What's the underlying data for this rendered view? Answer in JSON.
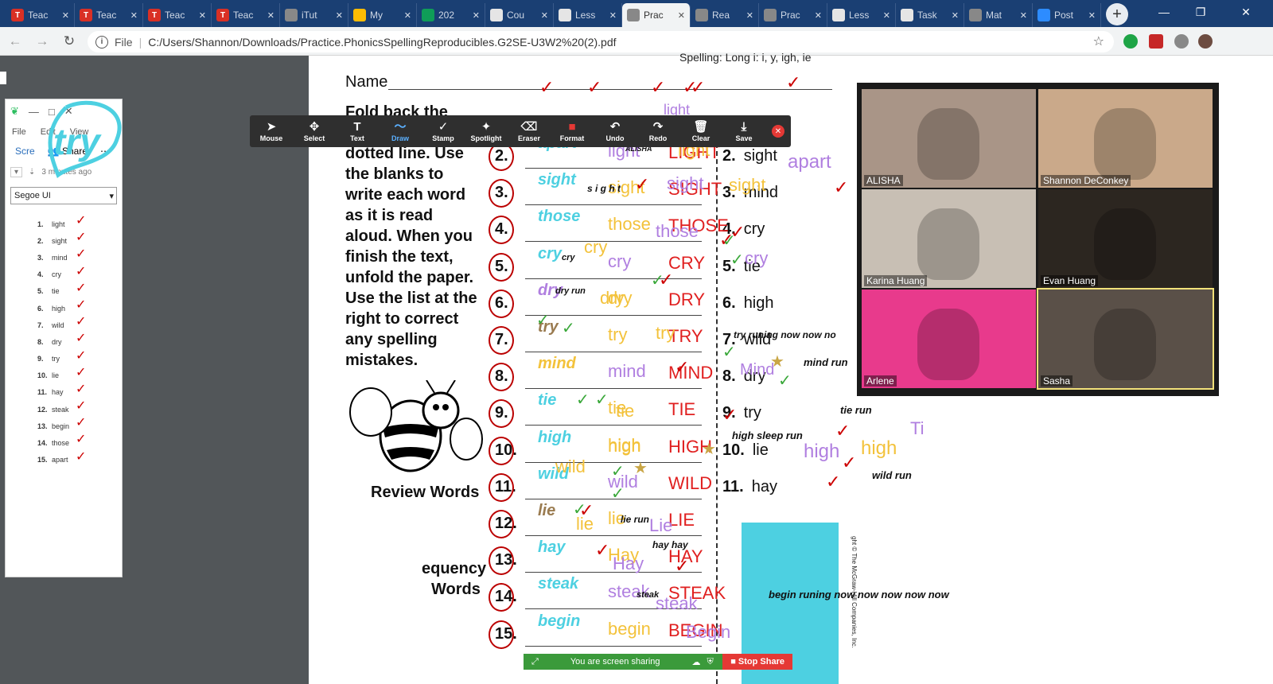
{
  "tabs": [
    {
      "label": "Teac",
      "icon": "teachable-icon",
      "color": "#d93025",
      "active": false
    },
    {
      "label": "Teac",
      "icon": "teachable-icon",
      "color": "#d93025",
      "active": false
    },
    {
      "label": "Teac",
      "icon": "teachable-icon",
      "color": "#d93025",
      "active": false
    },
    {
      "label": "Teac",
      "icon": "teachable-icon",
      "color": "#d93025",
      "active": false
    },
    {
      "label": "iTut",
      "icon": "itutor-icon",
      "color": "#888888",
      "active": false
    },
    {
      "label": "My",
      "icon": "drive-icon",
      "color": "#fbbc04",
      "active": false
    },
    {
      "label": "202",
      "icon": "sheets-icon",
      "color": "#0f9d58",
      "active": false
    },
    {
      "label": "Cou",
      "icon": "classroom-icon",
      "color": "#e5e5e5",
      "active": false
    },
    {
      "label": "Less",
      "icon": "lesson-icon",
      "color": "#e5e5e5",
      "active": false
    },
    {
      "label": "Prac",
      "icon": "pdf-icon",
      "color": "#888888",
      "active": true
    },
    {
      "label": "Rea",
      "icon": "pdf-icon",
      "color": "#888888",
      "active": false
    },
    {
      "label": "Prac",
      "icon": "pdf-icon",
      "color": "#888888",
      "active": false
    },
    {
      "label": "Less",
      "icon": "lesson-icon",
      "color": "#e5e5e5",
      "active": false
    },
    {
      "label": "Task",
      "icon": "lesson-icon",
      "color": "#e5e5e5",
      "active": false
    },
    {
      "label": "Mat",
      "icon": "pdf-icon",
      "color": "#888888",
      "active": false
    },
    {
      "label": "Post",
      "icon": "zoom-icon",
      "color": "#2d8cff",
      "active": false
    }
  ],
  "address": {
    "scheme": "File",
    "url": "C:/Users/Shannon/Downloads/Practice.PhonicsSpellingReproducibles.G2SE-U3W2%20(2).pdf"
  },
  "notes_app": {
    "menu": [
      "File",
      "Edit",
      "View"
    ],
    "screen_label": "Scre",
    "share_label": "Share",
    "time_label": "3 minutes ago",
    "font": "Segoe UI",
    "handwritten": "try",
    "list": [
      {
        "n": "1.",
        "w": "light"
      },
      {
        "n": "2.",
        "w": "sight"
      },
      {
        "n": "3.",
        "w": "mind"
      },
      {
        "n": "4.",
        "w": "cry"
      },
      {
        "n": "5.",
        "w": "tie"
      },
      {
        "n": "6.",
        "w": "high"
      },
      {
        "n": "7.",
        "w": "wild"
      },
      {
        "n": "8.",
        "w": "dry"
      },
      {
        "n": "9.",
        "w": "try"
      },
      {
        "n": "10.",
        "w": "lie"
      },
      {
        "n": "11.",
        "w": "hay"
      },
      {
        "n": "12.",
        "w": "steak"
      },
      {
        "n": "13.",
        "w": "begin"
      },
      {
        "n": "14.",
        "w": "those"
      },
      {
        "n": "15.",
        "w": "apart"
      }
    ]
  },
  "annotate_toolbar": [
    {
      "label": "Mouse",
      "icon": "mouse-pointer-icon",
      "glyph": "➤"
    },
    {
      "label": "Select",
      "icon": "move-icon",
      "glyph": "✥"
    },
    {
      "label": "Text",
      "icon": "text-icon",
      "glyph": "T"
    },
    {
      "label": "Draw",
      "icon": "draw-icon",
      "glyph": "〜",
      "active": true
    },
    {
      "label": "Stamp",
      "icon": "stamp-icon",
      "glyph": "✓"
    },
    {
      "label": "Spotlight",
      "icon": "spotlight-icon",
      "glyph": "✦"
    },
    {
      "label": "Eraser",
      "icon": "eraser-icon",
      "glyph": "⌫"
    },
    {
      "label": "Format",
      "icon": "format-icon",
      "glyph": "■"
    },
    {
      "label": "Undo",
      "icon": "undo-icon",
      "glyph": "↶"
    },
    {
      "label": "Redo",
      "icon": "redo-icon",
      "glyph": "↷"
    },
    {
      "label": "Clear",
      "icon": "trash-icon",
      "glyph": "🗑"
    },
    {
      "label": "Save",
      "icon": "save-icon",
      "glyph": "⤓"
    }
  ],
  "worksheet": {
    "header": "Spelling: Long i: i, y, igh, ie",
    "name_label": "Name",
    "instructions": [
      "Fold back the",
      "paper along the",
      "dotted line. Use",
      "the blanks to",
      "write each word",
      "as it is read",
      "aloud. When you",
      "finish the text,",
      "unfold the paper.",
      "Use the list at the",
      "right to correct",
      "any spelling",
      "mistakes."
    ],
    "review_words": "Review Words",
    "high_freq": [
      "equency",
      "Words"
    ],
    "copyright": "ght © The McGraw-Hill Companies, Inc.",
    "nums": [
      "2.",
      "3.",
      "4.",
      "5.",
      "6.",
      "7.",
      "8.",
      "9.",
      "10.",
      "11.",
      "12.",
      "13.",
      "14.",
      "15."
    ],
    "right_list": [
      {
        "n": "2.",
        "w": "sight"
      },
      {
        "n": "3.",
        "w": "mind"
      },
      {
        "n": "4.",
        "w": "cry"
      },
      {
        "n": "5.",
        "w": "tie"
      },
      {
        "n": "6.",
        "w": "high"
      },
      {
        "n": "7.",
        "w": "wild"
      },
      {
        "n": "8.",
        "w": "dry"
      },
      {
        "n": "9.",
        "w": "try"
      },
      {
        "n": "10.",
        "w": "lie"
      },
      {
        "n": "11.",
        "w": "hay"
      }
    ]
  },
  "annotations": {
    "col1": [
      "apart",
      "sight",
      "those",
      "cry",
      "dry",
      "try",
      "mind",
      "tie",
      "high",
      "wild",
      "lie",
      "hay",
      "steak",
      "begin"
    ],
    "col1_colors": [
      "#4dd0e1",
      "#4dd0e1",
      "#4dd0e1",
      "#4dd0e1",
      "#b07fe0",
      "#9a7b50",
      "#f3c23b",
      "#4dd0e1",
      "#4dd0e1",
      "#4dd0e1",
      "#9a7b50",
      "#4dd0e1",
      "#4dd0e1",
      "#4dd0e1"
    ],
    "col2": [
      "light",
      "sight",
      "those",
      "cry",
      "dry",
      "try",
      "mind",
      "tie",
      "high",
      "wild",
      "lie",
      "Hay",
      "steak",
      "begin"
    ],
    "col3": [
      "LIGHT",
      "SIGHT",
      "THOSE",
      "CRY",
      "DRY",
      "TRY",
      "MIND",
      "TIE",
      "HIGH",
      "WILD",
      "LIE",
      "HAY",
      "STEAK",
      "BEGIN"
    ],
    "small_black": {
      "alisha": "ALISHA",
      "sight_small": "s i g h t",
      "cry_small": "cry",
      "dry_run": "dry run",
      "try_runing": "try runing now now no",
      "mind_run": "mind run",
      "tie_run": "tie run",
      "high_sleep": "high sleep run",
      "wild_run": "wild run",
      "lie_run": "lie run",
      "hay_hay": "hay hay",
      "steak_small": "steak",
      "begin_runing": "begin runing now now now now now"
    },
    "purple_extra": [
      "light",
      "apart",
      "sight",
      "those",
      "cry",
      "Mind",
      "high",
      "Lie",
      "Hay",
      "steak",
      "Begin",
      "Ti"
    ],
    "gold_extra": [
      "light",
      "sight",
      "cry",
      "dry",
      "try",
      "tie",
      "high",
      "wild",
      "lie",
      "high"
    ]
  },
  "participants": [
    {
      "name": "ALISHA",
      "bg": "#a99587"
    },
    {
      "name": "Shannon DeConkey",
      "bg": "#caa98a"
    },
    {
      "name": "Karina Huang",
      "bg": "#c8bfb4"
    },
    {
      "name": "Evan Huang",
      "bg": "#2c2620"
    },
    {
      "name": "Arlene",
      "bg": "#e83a8c"
    },
    {
      "name": "Sasha",
      "bg": "#5a5048"
    }
  ],
  "sharebar": {
    "status": "You are screen sharing",
    "stop": "Stop Share"
  },
  "colors": {
    "cyan": "#4dd0e1",
    "red": "#e02020",
    "purple": "#b07fe0",
    "gold": "#f3c23b",
    "green": "#3aa83a",
    "brown": "#8a6a3a"
  }
}
